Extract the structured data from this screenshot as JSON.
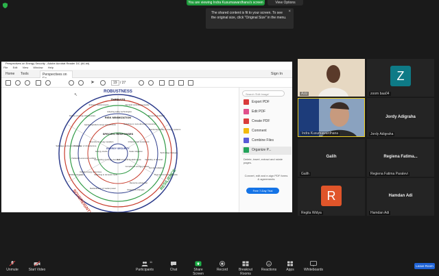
{
  "banner": {
    "viewing_text": "You are viewing Indra Kusumawardhana's screen",
    "view_options": "View Options"
  },
  "tooltip": {
    "text": "The shared content is fit to your screen. To see the original size, click \"Original Size\" in the menu.",
    "close": "×"
  },
  "acrobat": {
    "title": "Perspectives on Energy Security - Adobe Acrobat Reader DC (64-bit)",
    "menu": [
      "File",
      "Edit",
      "View",
      "Window",
      "Help"
    ],
    "tabs": {
      "home": "Home",
      "tools": "Tools",
      "document": "Perspectives on En..."
    },
    "sign_in": "Sign In",
    "page": {
      "current": "19",
      "total": "/ 27"
    },
    "panel": {
      "search_placeholder": "Search 'Edit Image'",
      "tools": [
        "Export PDF",
        "Edit PDF",
        "Create PDF",
        "Comment",
        "Combine Files",
        "Organize P..."
      ],
      "description": "Delete, insert, extract and rotate pages.",
      "promo": "Convert, edit and e-sign PDF forms & agreements",
      "trial_button": "Free 7-Day Trial"
    },
    "tool_colors": [
      "#d93b3b",
      "#e0508c",
      "#d93b3b",
      "#f2b90c",
      "#5a5ad8",
      "#23a35a"
    ]
  },
  "diagram": {
    "ring_titles": [
      "ROBUSTNESS",
      "SOVEREIGNTY",
      "RESILIENCE"
    ],
    "sections": [
      "THREATS",
      "RISK MINIMIZATION",
      "SPECIFIC RESPONSES",
      "ENERGY SECURITY"
    ],
    "items": [
      "Extreme natural events",
      "Demand outstripping supply",
      "Resource depletion",
      "Failure of energy infrastructure",
      "Aging/degraded energy infrastructure",
      "Adopting safety technologies",
      "Switching to more abundant resources",
      "Intentional hostility to energy systems",
      "Diversity of energy suppliers",
      "Infrastructure investment",
      "Technology changes",
      "Sabotage and terrorist attacks",
      "Protection of infrastructure",
      "Energy stocks",
      "Scale mitigation",
      "Variability of demand",
      "Political & economic conflicts",
      "Decoupling of energy demand",
      "Technological breakthroughs",
      "Compliance energy markets",
      "Political strategies",
      "Switching to domestic fuels",
      "Volatile energy and prices",
      "Post-environmental shocks",
      "Redistribution of market power",
      "Resource exhaustion",
      "Demand adaption",
      "Regulatory changes"
    ]
  },
  "participants": [
    {
      "name": "Aziz",
      "type": "video"
    },
    {
      "name": "zoom baa04",
      "type": "avatar",
      "letter": "Z",
      "color": "#0e7a86"
    },
    {
      "name": "Indra Kusumawardhana",
      "type": "video"
    },
    {
      "name": "Jordy Adigraha",
      "type": "name"
    },
    {
      "name": "Galih",
      "type": "name"
    },
    {
      "name": "Regiena  Fatima...",
      "label": "Regiena Fatima Paralevi",
      "type": "name"
    },
    {
      "name": "Regita Widya",
      "type": "avatar",
      "letter": "R",
      "color": "#e0552a"
    },
    {
      "name": "Hamdan Adi",
      "type": "name"
    }
  ],
  "toolbar": {
    "unmute": "Unmute",
    "start_video": "Start Video",
    "participants": "Participants",
    "participants_count": "11",
    "chat": "Chat",
    "share_screen": "Share Screen",
    "record": "Record",
    "breakout": "Breakout Rooms",
    "reactions": "Reactions",
    "apps": "Apps",
    "whiteboards": "Whiteboards",
    "leave": "Leave Room"
  }
}
